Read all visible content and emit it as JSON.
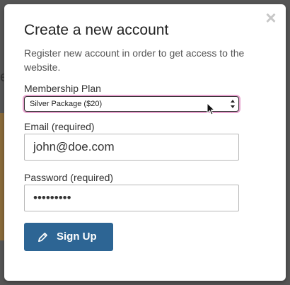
{
  "modal": {
    "close_icon": "close-icon",
    "title": "Create a new account",
    "subtitle": "Register new account in order to get access to the website."
  },
  "form": {
    "membership": {
      "label": "Membership Plan",
      "selected": "Silver Package ($20)",
      "focus_color": "#e7a3cf"
    },
    "email": {
      "label": "Email (required)",
      "value": "john@doe.com"
    },
    "password": {
      "label": "Password (required)",
      "masked_value": "•••••••••"
    },
    "submit": {
      "label": "Sign Up",
      "icon": "pencil-icon",
      "color": "#2d6594"
    }
  }
}
